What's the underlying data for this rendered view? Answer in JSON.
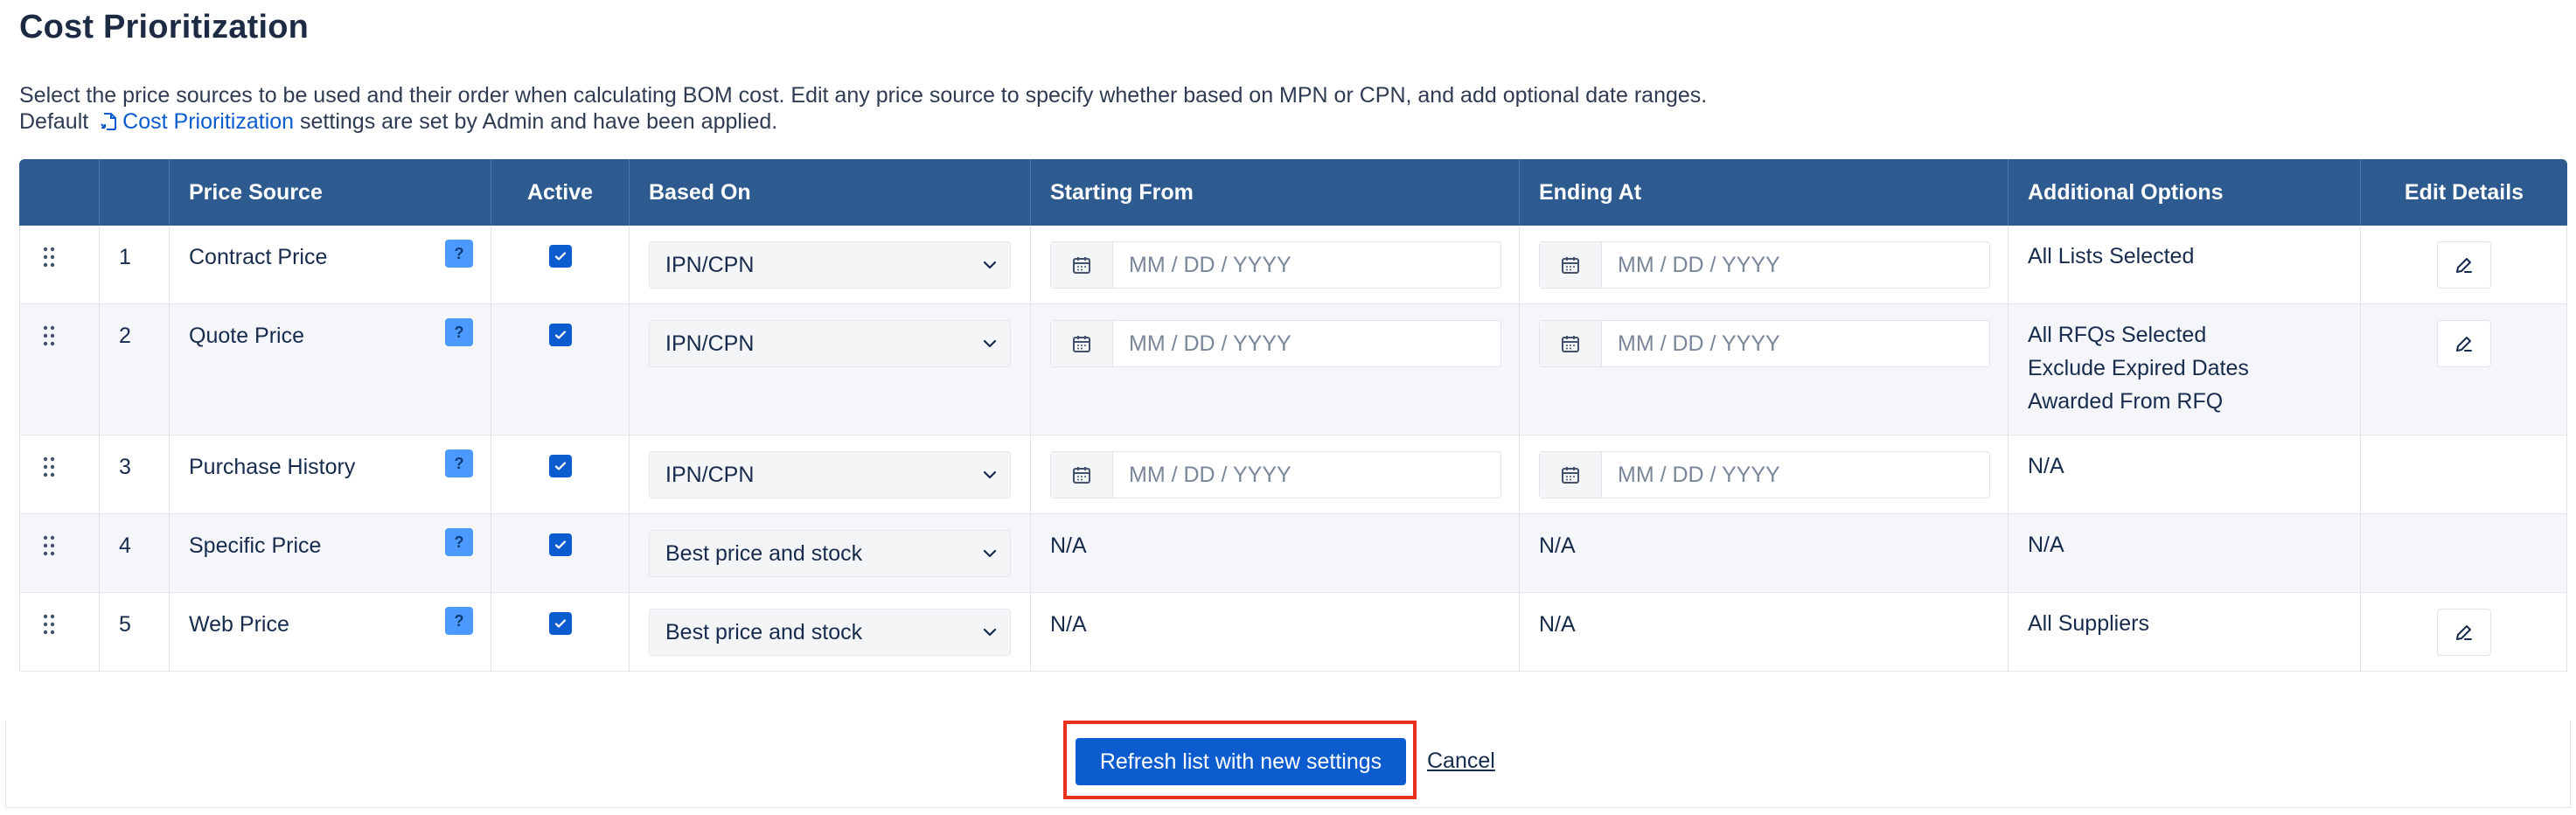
{
  "page": {
    "title": "Cost Prioritization",
    "description_line1": "Select the price sources to be used and their order when calculating BOM cost. Edit any price source to specify whether based on MPN or CPN, and add optional date ranges.",
    "description_prefix": "Default",
    "description_link": "Cost Prioritization",
    "description_suffix": "settings are set by Admin and have been applied."
  },
  "table": {
    "headers": {
      "price_source": "Price Source",
      "active": "Active",
      "based_on": "Based On",
      "starting_from": "Starting From",
      "ending_at": "Ending At",
      "additional_options": "Additional Options",
      "edit_details": "Edit Details"
    },
    "help_glyph": "?",
    "date_placeholder": "MM / DD / YYYY",
    "rows": [
      {
        "num": "1",
        "source": "Contract Price",
        "active": true,
        "based_on": "IPN/CPN",
        "start": "",
        "end": "",
        "options": [
          "All Lists Selected"
        ],
        "editable": true
      },
      {
        "num": "2",
        "source": "Quote Price",
        "active": true,
        "based_on": "IPN/CPN",
        "start": "",
        "end": "",
        "options": [
          "All RFQs Selected",
          "Exclude Expired Dates",
          "Awarded From RFQ"
        ],
        "editable": true
      },
      {
        "num": "3",
        "source": "Purchase History",
        "active": true,
        "based_on": "IPN/CPN",
        "start": "",
        "end": "",
        "options": [
          "N/A"
        ],
        "editable": false
      },
      {
        "num": "4",
        "source": "Specific Price",
        "active": true,
        "based_on": "Best price and stock",
        "start_text": "N/A",
        "end_text": "N/A",
        "options": [
          "N/A"
        ],
        "editable": false
      },
      {
        "num": "5",
        "source": "Web Price",
        "active": true,
        "based_on": "Best price and stock",
        "start_text": "N/A",
        "end_text": "N/A",
        "options": [
          "All Suppliers"
        ],
        "editable": true
      }
    ]
  },
  "footer": {
    "refresh_label": "Refresh list with new settings",
    "cancel_label": "Cancel"
  },
  "colors": {
    "header_bg": "#2d5a8f",
    "primary": "#0c5ccf",
    "help_badge": "#4c9aff",
    "highlight_border": "#e8321e"
  }
}
